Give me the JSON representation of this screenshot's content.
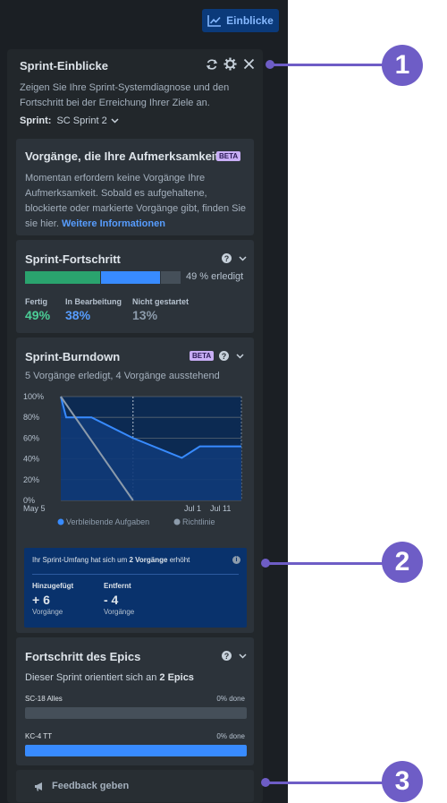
{
  "header": {
    "insights_button": "Einblicke"
  },
  "panel": {
    "title": "Sprint-Einblicke",
    "description": "Zeigen Sie Ihre Sprint-Systemdiagnose und den Fortschritt bei der Erreichung Ihrer Ziele an.",
    "sprint_label": "Sprint:",
    "sprint_value": "SC Sprint 2"
  },
  "attention": {
    "title": "Vorgänge, die Ihre Aufmerksamkeit...",
    "badge": "BETA",
    "text": "Momentan erfordern keine Vorgänge Ihre Aufmerksamkeit. Sobald es aufgehaltene, blockierte oder markierte Vorgänge gibt, finden Sie sie hier.",
    "link": "Weitere Informationen"
  },
  "progress": {
    "title": "Sprint-Fortschritt",
    "pct_label": "49 % erledigt",
    "done_fraction": 0.49,
    "inprogress_fraction": 0.38,
    "todo_fraction": 0.13,
    "stats": [
      {
        "label": "Fertig",
        "value": "49%"
      },
      {
        "label": "In Bearbeitung",
        "value": "38%"
      },
      {
        "label": "Nicht gestartet",
        "value": "13%"
      }
    ]
  },
  "burndown": {
    "title": "Sprint-Burndown",
    "badge": "BETA",
    "subtitle": "5 Vorgänge erledigt, 4 Vorgänge ausstehend",
    "scope": {
      "message_pre": "Ihr Sprint-Umfang hat sich um ",
      "message_bold": "2 Vorgänge",
      "message_post": " erhöht",
      "added_label": "Hinzugefügt",
      "added_value": "+ 6",
      "added_unit": "Vorgänge",
      "removed_label": "Entfernt",
      "removed_value": "- 4",
      "removed_unit": "Vorgänge"
    }
  },
  "chart_data": {
    "type": "line",
    "y_tick_labels": [
      "100%",
      "80%",
      "60%",
      "40%",
      "20%",
      "0%"
    ],
    "x_tick_labels": [
      "May 5",
      "Jul 1",
      "Jul 11"
    ],
    "ylim": [
      0,
      100
    ],
    "series": [
      {
        "name": "Verbleibende Aufgaben",
        "color": "#388bff",
        "points": [
          [
            0,
            100
          ],
          [
            0.03,
            80
          ],
          [
            0.17,
            80
          ],
          [
            0.4,
            60
          ],
          [
            0.67,
            41
          ],
          [
            0.77,
            52
          ],
          [
            1.0,
            52
          ]
        ]
      },
      {
        "name": "Richtlinie",
        "color": "#8c9bab",
        "points": [
          [
            0,
            100
          ],
          [
            0.4,
            0
          ]
        ]
      }
    ],
    "marker_position": 0.4,
    "legend": "bottom"
  },
  "epics": {
    "title": "Fortschritt des Epics",
    "subtitle_pre": "Dieser Sprint orientiert sich an ",
    "subtitle_bold": "2 Epics",
    "items": [
      {
        "name": "SC-18 Alles",
        "pct": "0% done",
        "color": "#454f59"
      },
      {
        "name": "KC-4 TT",
        "pct": "0% done",
        "color": "#388bff"
      }
    ]
  },
  "feedback": {
    "label": "Feedback geben"
  },
  "callouts": [
    "1",
    "2",
    "3"
  ]
}
